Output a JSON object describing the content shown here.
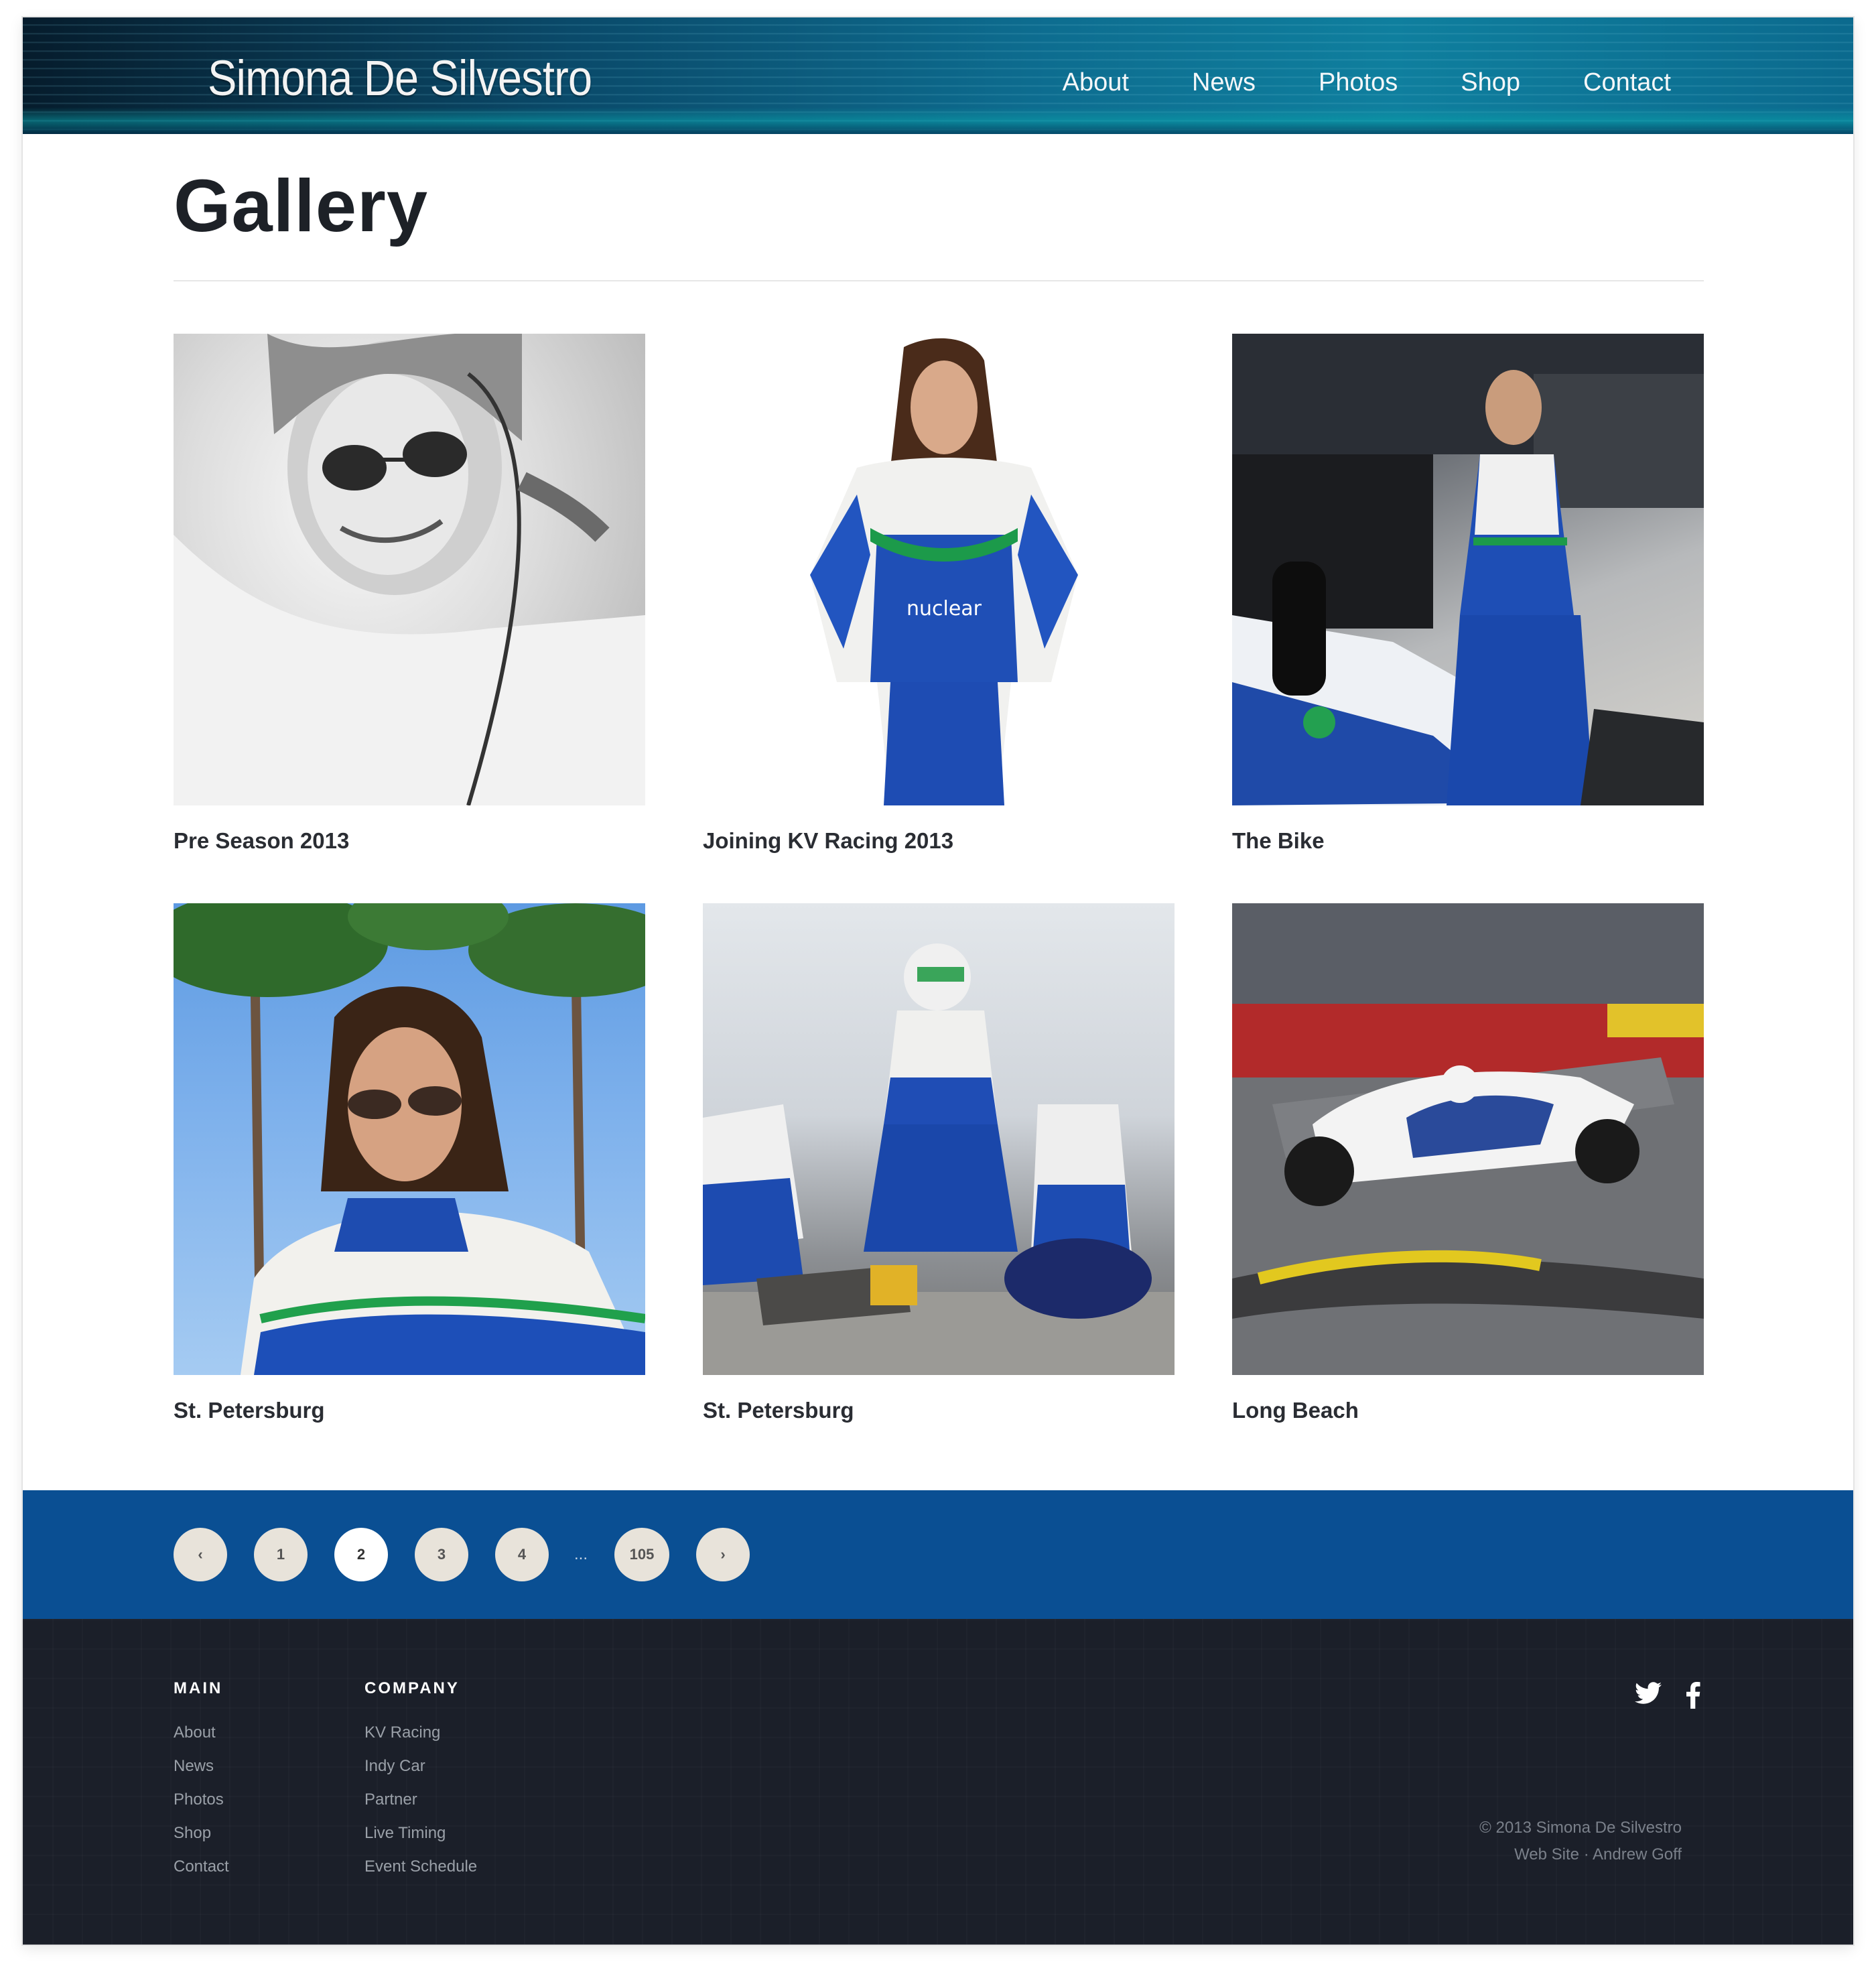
{
  "site": {
    "logo": "Simona De Silvestro"
  },
  "nav": [
    {
      "label": "About"
    },
    {
      "label": "News"
    },
    {
      "label": "Photos"
    },
    {
      "label": "Shop"
    },
    {
      "label": "Contact"
    }
  ],
  "page": {
    "title": "Gallery"
  },
  "gallery": [
    {
      "caption": "Pre Season 2013"
    },
    {
      "caption": "Joining KV Racing 2013"
    },
    {
      "caption": "The Bike"
    },
    {
      "caption": "St. Petersburg"
    },
    {
      "caption": "St. Petersburg"
    },
    {
      "caption": "Long Beach"
    }
  ],
  "pagination": {
    "prev": "‹",
    "pages": [
      "1",
      "2",
      "3",
      "4"
    ],
    "current": "2",
    "ellipsis": "...",
    "last": "105",
    "next": "›"
  },
  "footer": {
    "main": {
      "heading": "MAIN",
      "links": [
        "About",
        "News",
        "Photos",
        "Shop",
        "Contact"
      ]
    },
    "company": {
      "heading": "COMPANY",
      "links": [
        "KV Racing",
        "Indy Car",
        "Partner",
        "Live Timing",
        "Event Schedule"
      ]
    },
    "social": [
      "twitter-icon",
      "facebook-icon"
    ],
    "copyright": "© 2013 Simona De Silvestro",
    "credit_label": "Web Site",
    "credit_separator": "·",
    "credit_name": "Andrew Goff"
  },
  "colors": {
    "pager_band": "#0a4f93",
    "footer_bg": "#1b1f29",
    "header_accent": "#0f7f9e"
  }
}
